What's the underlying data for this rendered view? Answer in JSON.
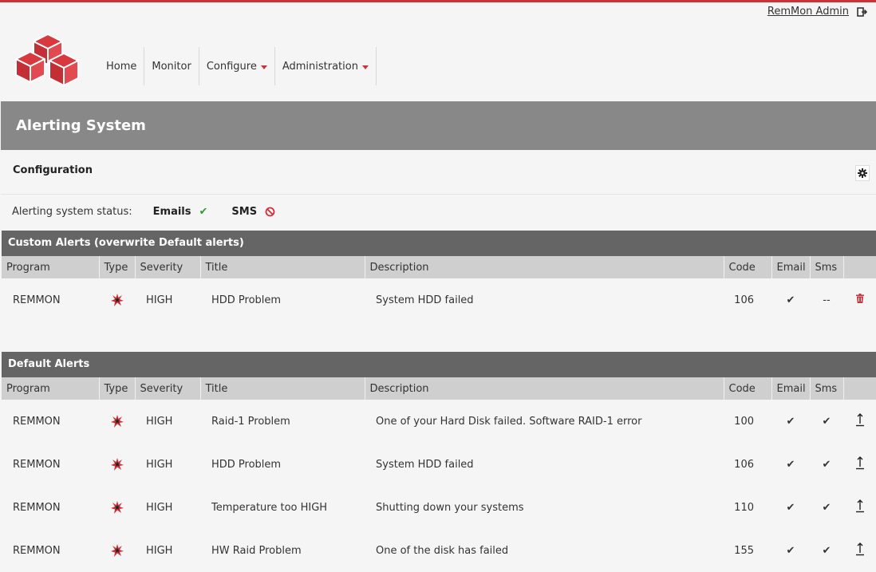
{
  "user": {
    "name": "RemMon Admin",
    "logout_icon": "logout-icon"
  },
  "nav": {
    "items": [
      {
        "label": "Home",
        "dropdown": false
      },
      {
        "label": "Monitor",
        "dropdown": false
      },
      {
        "label": "Configure",
        "dropdown": true
      },
      {
        "label": "Administration",
        "dropdown": true
      }
    ]
  },
  "page": {
    "title": "Alerting System"
  },
  "config": {
    "title": "Configuration",
    "status_label": "Alerting system status:",
    "emails_label": "Emails",
    "emails_status": "✔",
    "sms_label": "SMS",
    "sms_status": "⊘"
  },
  "columns": [
    "Program",
    "Type",
    "Severity",
    "Title",
    "Description",
    "Code",
    "Email",
    "Sms",
    ""
  ],
  "custom_alerts": {
    "header": "Custom Alerts (overwrite Default alerts)",
    "rows": [
      {
        "program": "REMMON",
        "severity": "HIGH",
        "title": "HDD Problem",
        "description": "System HDD failed",
        "code": "106",
        "email": "✔",
        "sms": "--"
      }
    ]
  },
  "default_alerts": {
    "header": "Default Alerts",
    "rows": [
      {
        "program": "REMMON",
        "severity": "HIGH",
        "title": "Raid-1 Problem",
        "description": "One of your Hard Disk failed. Software RAID-1 error",
        "code": "100",
        "email": "✔",
        "sms": "✔"
      },
      {
        "program": "REMMON",
        "severity": "HIGH",
        "title": "HDD Problem",
        "description": "System HDD failed",
        "code": "106",
        "email": "✔",
        "sms": "✔"
      },
      {
        "program": "REMMON",
        "severity": "HIGH",
        "title": "Temperature too HIGH",
        "description": "Shutting down your systems",
        "code": "110",
        "email": "✔",
        "sms": "✔"
      },
      {
        "program": "REMMON",
        "severity": "HIGH",
        "title": "HW Raid Problem",
        "description": "One of the disk has failed",
        "code": "155",
        "email": "✔",
        "sms": "✔"
      }
    ]
  },
  "colors": {
    "accent": "#c9343a",
    "title_band": "#888888",
    "section_header": "#656565",
    "ok_green": "#2a9d2a"
  }
}
